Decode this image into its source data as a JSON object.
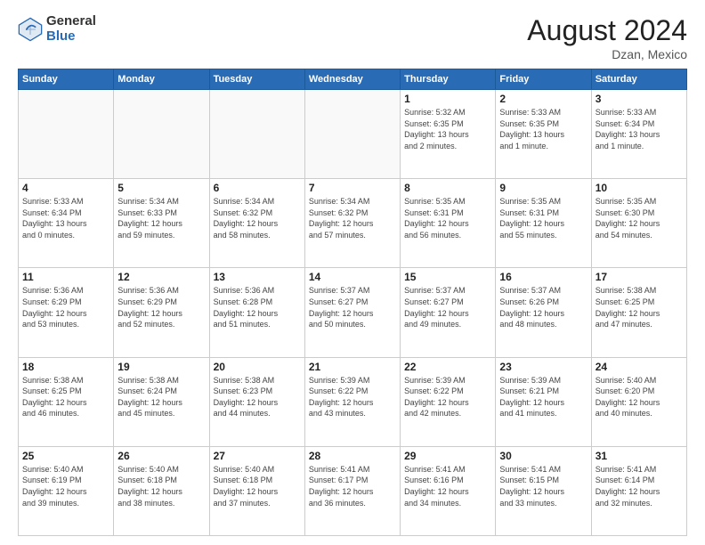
{
  "header": {
    "logo_general": "General",
    "logo_blue": "Blue",
    "month_year": "August 2024",
    "location": "Dzan, Mexico"
  },
  "days_of_week": [
    "Sunday",
    "Monday",
    "Tuesday",
    "Wednesday",
    "Thursday",
    "Friday",
    "Saturday"
  ],
  "weeks": [
    [
      {
        "day": "",
        "info": ""
      },
      {
        "day": "",
        "info": ""
      },
      {
        "day": "",
        "info": ""
      },
      {
        "day": "",
        "info": ""
      },
      {
        "day": "1",
        "info": "Sunrise: 5:32 AM\nSunset: 6:35 PM\nDaylight: 13 hours\nand 2 minutes."
      },
      {
        "day": "2",
        "info": "Sunrise: 5:33 AM\nSunset: 6:35 PM\nDaylight: 13 hours\nand 1 minute."
      },
      {
        "day": "3",
        "info": "Sunrise: 5:33 AM\nSunset: 6:34 PM\nDaylight: 13 hours\nand 1 minute."
      }
    ],
    [
      {
        "day": "4",
        "info": "Sunrise: 5:33 AM\nSunset: 6:34 PM\nDaylight: 13 hours\nand 0 minutes."
      },
      {
        "day": "5",
        "info": "Sunrise: 5:34 AM\nSunset: 6:33 PM\nDaylight: 12 hours\nand 59 minutes."
      },
      {
        "day": "6",
        "info": "Sunrise: 5:34 AM\nSunset: 6:32 PM\nDaylight: 12 hours\nand 58 minutes."
      },
      {
        "day": "7",
        "info": "Sunrise: 5:34 AM\nSunset: 6:32 PM\nDaylight: 12 hours\nand 57 minutes."
      },
      {
        "day": "8",
        "info": "Sunrise: 5:35 AM\nSunset: 6:31 PM\nDaylight: 12 hours\nand 56 minutes."
      },
      {
        "day": "9",
        "info": "Sunrise: 5:35 AM\nSunset: 6:31 PM\nDaylight: 12 hours\nand 55 minutes."
      },
      {
        "day": "10",
        "info": "Sunrise: 5:35 AM\nSunset: 6:30 PM\nDaylight: 12 hours\nand 54 minutes."
      }
    ],
    [
      {
        "day": "11",
        "info": "Sunrise: 5:36 AM\nSunset: 6:29 PM\nDaylight: 12 hours\nand 53 minutes."
      },
      {
        "day": "12",
        "info": "Sunrise: 5:36 AM\nSunset: 6:29 PM\nDaylight: 12 hours\nand 52 minutes."
      },
      {
        "day": "13",
        "info": "Sunrise: 5:36 AM\nSunset: 6:28 PM\nDaylight: 12 hours\nand 51 minutes."
      },
      {
        "day": "14",
        "info": "Sunrise: 5:37 AM\nSunset: 6:27 PM\nDaylight: 12 hours\nand 50 minutes."
      },
      {
        "day": "15",
        "info": "Sunrise: 5:37 AM\nSunset: 6:27 PM\nDaylight: 12 hours\nand 49 minutes."
      },
      {
        "day": "16",
        "info": "Sunrise: 5:37 AM\nSunset: 6:26 PM\nDaylight: 12 hours\nand 48 minutes."
      },
      {
        "day": "17",
        "info": "Sunrise: 5:38 AM\nSunset: 6:25 PM\nDaylight: 12 hours\nand 47 minutes."
      }
    ],
    [
      {
        "day": "18",
        "info": "Sunrise: 5:38 AM\nSunset: 6:25 PM\nDaylight: 12 hours\nand 46 minutes."
      },
      {
        "day": "19",
        "info": "Sunrise: 5:38 AM\nSunset: 6:24 PM\nDaylight: 12 hours\nand 45 minutes."
      },
      {
        "day": "20",
        "info": "Sunrise: 5:38 AM\nSunset: 6:23 PM\nDaylight: 12 hours\nand 44 minutes."
      },
      {
        "day": "21",
        "info": "Sunrise: 5:39 AM\nSunset: 6:22 PM\nDaylight: 12 hours\nand 43 minutes."
      },
      {
        "day": "22",
        "info": "Sunrise: 5:39 AM\nSunset: 6:22 PM\nDaylight: 12 hours\nand 42 minutes."
      },
      {
        "day": "23",
        "info": "Sunrise: 5:39 AM\nSunset: 6:21 PM\nDaylight: 12 hours\nand 41 minutes."
      },
      {
        "day": "24",
        "info": "Sunrise: 5:40 AM\nSunset: 6:20 PM\nDaylight: 12 hours\nand 40 minutes."
      }
    ],
    [
      {
        "day": "25",
        "info": "Sunrise: 5:40 AM\nSunset: 6:19 PM\nDaylight: 12 hours\nand 39 minutes."
      },
      {
        "day": "26",
        "info": "Sunrise: 5:40 AM\nSunset: 6:18 PM\nDaylight: 12 hours\nand 38 minutes."
      },
      {
        "day": "27",
        "info": "Sunrise: 5:40 AM\nSunset: 6:18 PM\nDaylight: 12 hours\nand 37 minutes."
      },
      {
        "day": "28",
        "info": "Sunrise: 5:41 AM\nSunset: 6:17 PM\nDaylight: 12 hours\nand 36 minutes."
      },
      {
        "day": "29",
        "info": "Sunrise: 5:41 AM\nSunset: 6:16 PM\nDaylight: 12 hours\nand 34 minutes."
      },
      {
        "day": "30",
        "info": "Sunrise: 5:41 AM\nSunset: 6:15 PM\nDaylight: 12 hours\nand 33 minutes."
      },
      {
        "day": "31",
        "info": "Sunrise: 5:41 AM\nSunset: 6:14 PM\nDaylight: 12 hours\nand 32 minutes."
      }
    ]
  ]
}
